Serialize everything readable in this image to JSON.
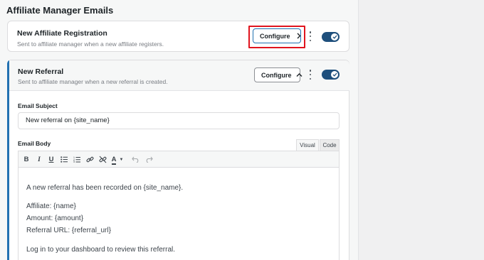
{
  "section_title": "Affiliate Manager Emails",
  "cards": [
    {
      "title": "New Affiliate Registration",
      "description": "Sent to affiliate manager when a new affiliate registers.",
      "configure_label": "Configure",
      "configure_icon": "chevron-right-icon",
      "enabled": true
    },
    {
      "title": "New Referral",
      "description": "Sent to affiliate manager when a new referral is created.",
      "configure_label": "Configure",
      "configure_icon": "chevron-up-icon",
      "enabled": true
    }
  ],
  "form": {
    "subject_label": "Email Subject",
    "subject_value": "New referral on {site_name}",
    "body_label": "Email Body",
    "tabs": [
      "Visual",
      "Code"
    ],
    "active_tab": "Visual"
  },
  "toolbar": {
    "bold": "B",
    "italic": "I",
    "underline": "U",
    "text_color": "A"
  },
  "body_lines": [
    "A new referral has been recorded on {site_name}.",
    "Affiliate: {name}",
    "Amount: {amount}",
    "Referral URL: {referral_url}",
    "Log in to your dashboard to review this referral."
  ],
  "colors": {
    "accent": "#2271b1",
    "toggle": "#1e4f7c",
    "highlight_box": "#e0141e"
  }
}
